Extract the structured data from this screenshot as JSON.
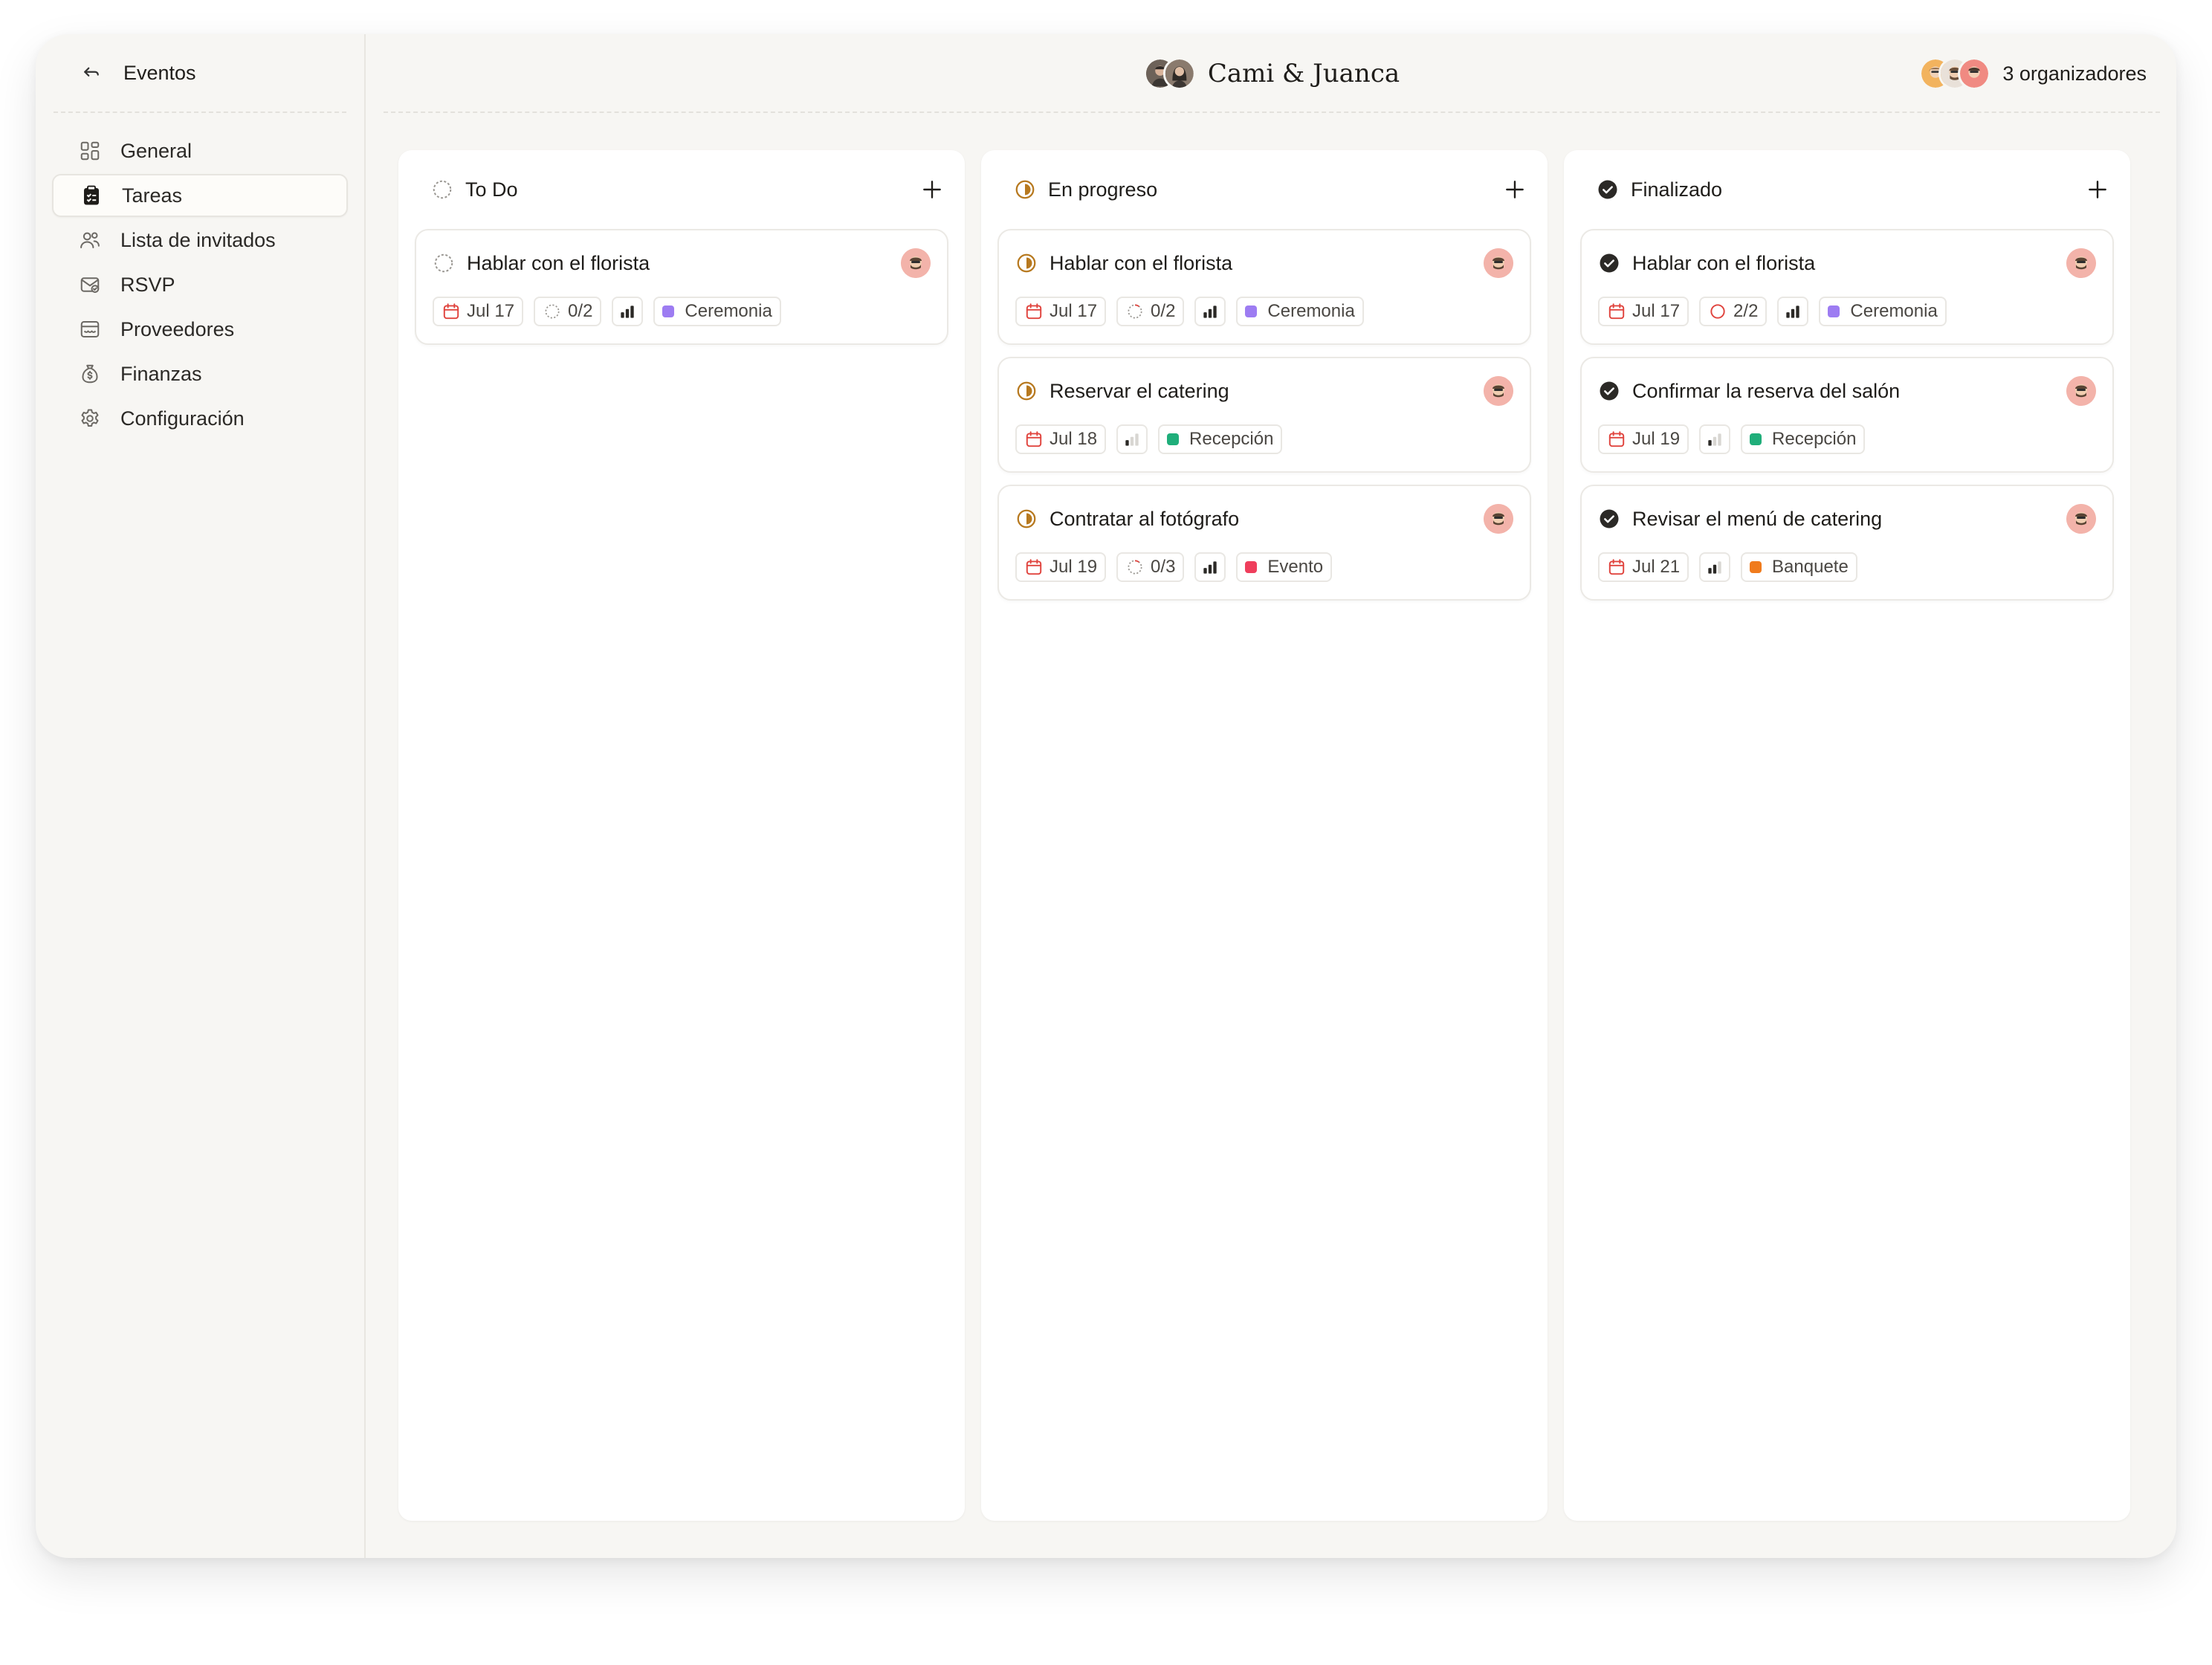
{
  "sidebar": {
    "back_label": "Eventos",
    "items": [
      {
        "label": "General",
        "icon": "grid-icon",
        "active": false
      },
      {
        "label": "Tareas",
        "icon": "clipboard-icon",
        "active": true
      },
      {
        "label": "Lista de invitados",
        "icon": "users-icon",
        "active": false
      },
      {
        "label": "RSVP",
        "icon": "mail-check-icon",
        "active": false
      },
      {
        "label": "Proveedores",
        "icon": "store-icon",
        "active": false
      },
      {
        "label": "Finanzas",
        "icon": "money-bag-icon",
        "active": false
      },
      {
        "label": "Configuración",
        "icon": "gear-icon",
        "active": false
      }
    ]
  },
  "header": {
    "title": "Cami & Juanca",
    "organizers_label": "3 organizadores"
  },
  "colors": {
    "accent_in_progress": "#b7791f",
    "done": "#2b2926",
    "calendar_red": "#e0443e",
    "tag_ceremonia": "#9d7cf2",
    "tag_recepcion": "#1fae7a",
    "tag_evento": "#ef3e5c",
    "tag_banquete": "#f07b1d"
  },
  "columns": [
    {
      "name": "To Do",
      "status": "todo",
      "cards": [
        {
          "title": "Hablar con el florista",
          "date": "Jul 17",
          "subtasks": "0/2",
          "priority": 3,
          "tag": "Ceremonia",
          "tag_color": "#9d7cf2"
        }
      ]
    },
    {
      "name": "En progreso",
      "status": "progress",
      "cards": [
        {
          "title": "Hablar con el florista",
          "date": "Jul 17",
          "subtasks": "0/2",
          "priority": 3,
          "tag": "Ceremonia",
          "tag_color": "#9d7cf2"
        },
        {
          "title": "Reservar el catering",
          "date": "Jul 18",
          "subtasks": "",
          "priority": 1,
          "tag": "Recepción",
          "tag_color": "#1fae7a"
        },
        {
          "title": "Contratar al fotógrafo",
          "date": "Jul 19",
          "subtasks": "0/3",
          "priority": 3,
          "tag": "Evento",
          "tag_color": "#ef3e5c"
        }
      ]
    },
    {
      "name": "Finalizado",
      "status": "done",
      "cards": [
        {
          "title": "Hablar con el florista",
          "date": "Jul 17",
          "subtasks": "2/2",
          "priority": 3,
          "tag": "Ceremonia",
          "tag_color": "#9d7cf2"
        },
        {
          "title": "Confirmar la reserva del salón",
          "date": "Jul 19",
          "subtasks": "",
          "priority": 1,
          "tag": "Recepción",
          "tag_color": "#1fae7a"
        },
        {
          "title": "Revisar el menú de catering",
          "date": "Jul 21",
          "subtasks": "",
          "priority": 2,
          "tag": "Banquete",
          "tag_color": "#f07b1d"
        }
      ]
    }
  ]
}
